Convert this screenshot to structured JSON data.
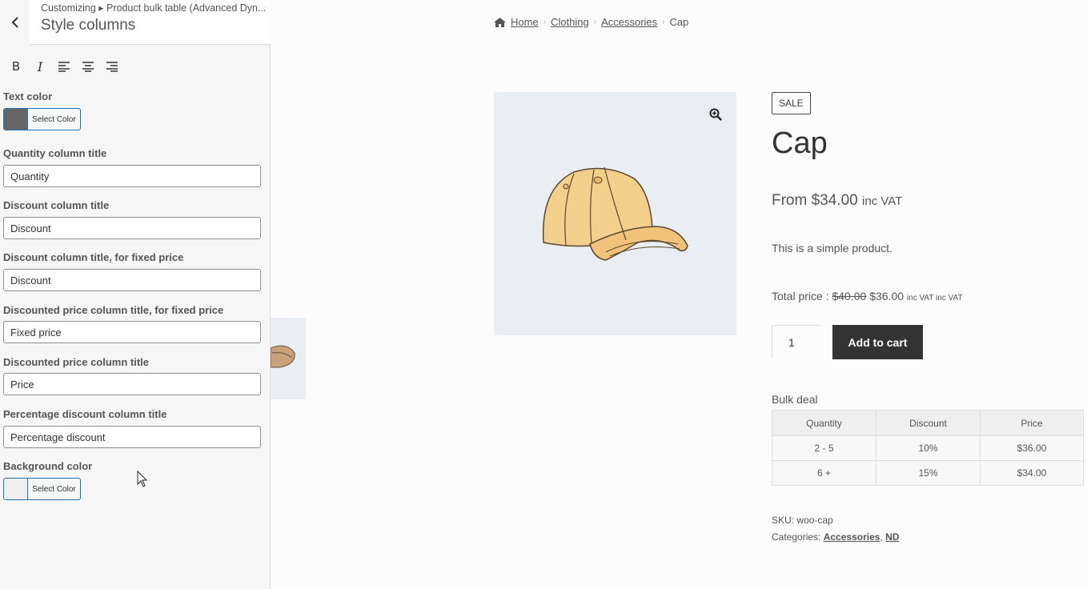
{
  "sidebar": {
    "breadcrumb": "Customizing ▸ Product bulk table (Advanced Dyn...",
    "section_title": "Style columns",
    "text_color_label": "Text color",
    "text_color_button": "Select Color",
    "text_color_value": "#666666",
    "fields": [
      {
        "label": "Quantity column title",
        "value": "Quantity"
      },
      {
        "label": "Discount column title",
        "value": "Discount"
      },
      {
        "label": "Discount column title, for fixed price",
        "value": "Discount"
      },
      {
        "label": "Discounted price column title, for fixed price",
        "value": "Fixed price"
      },
      {
        "label": "Discounted price column title",
        "value": "Price"
      },
      {
        "label": "Percentage discount column title",
        "value": "Percentage discount"
      }
    ],
    "bg_color_label": "Background color",
    "bg_color_button": "Select Color",
    "bg_color_value": "#efefef"
  },
  "breadcrumb": {
    "home": "Home",
    "items": [
      "Clothing",
      "Accessories"
    ],
    "current": "Cap"
  },
  "product": {
    "badge": "SALE",
    "title": "Cap",
    "price_prefix": "From",
    "price": "$34.00",
    "price_suffix": "inc VAT",
    "description": "This is a simple product.",
    "total_label": "Total price :",
    "total_old": "$40.00",
    "total_new": "$36.00",
    "total_suffix": "inc VAT inc VAT",
    "quantity": "1",
    "add_to_cart": "Add to cart"
  },
  "bulk": {
    "title": "Bulk deal",
    "headers": [
      "Quantity",
      "Discount",
      "Price"
    ],
    "rows": [
      [
        "2 - 5",
        "10%",
        "$36.00"
      ],
      [
        "6 +",
        "15%",
        "$34.00"
      ]
    ]
  },
  "meta": {
    "sku_label": "SKU:",
    "sku": "woo-cap",
    "categories_label": "Categories:",
    "categories": [
      "Accessories",
      "ND"
    ]
  }
}
